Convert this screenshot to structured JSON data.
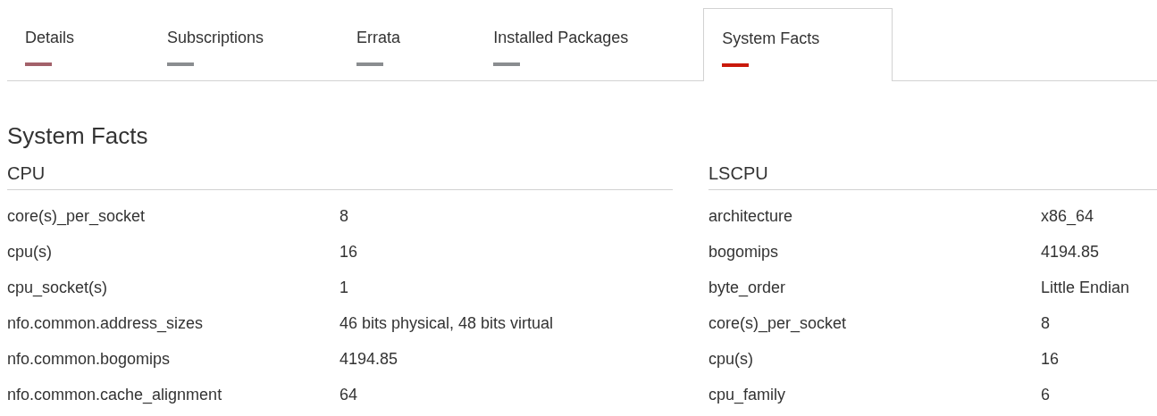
{
  "tabs": [
    {
      "label": "Details",
      "selected": false,
      "hovered": true
    },
    {
      "label": "Subscriptions",
      "selected": false,
      "hovered": false
    },
    {
      "label": "Errata",
      "selected": false,
      "hovered": false
    },
    {
      "label": "Installed Packages",
      "selected": false,
      "hovered": false
    },
    {
      "label": "System Facts",
      "selected": true,
      "hovered": false
    }
  ],
  "title": "System Facts",
  "sections": [
    {
      "heading": "CPU",
      "rows": [
        {
          "key": "core(s)_per_socket",
          "value": "8"
        },
        {
          "key": "cpu(s)",
          "value": "16"
        },
        {
          "key": "cpu_socket(s)",
          "value": "1"
        },
        {
          "key": "nfo.common.address_sizes",
          "value": "46 bits physical, 48 bits virtual"
        },
        {
          "key": "nfo.common.bogomips",
          "value": "4194.85"
        },
        {
          "key": "nfo.common.cache_alignment",
          "value": "64"
        }
      ]
    },
    {
      "heading": "LSCPU",
      "rows": [
        {
          "key": "architecture",
          "value": "x86_64"
        },
        {
          "key": "bogomips",
          "value": "4194.85"
        },
        {
          "key": "byte_order",
          "value": "Little Endian"
        },
        {
          "key": "core(s)_per_socket",
          "value": "8"
        },
        {
          "key": "cpu(s)",
          "value": "16"
        },
        {
          "key": "cpu_family",
          "value": "6"
        }
      ]
    }
  ]
}
